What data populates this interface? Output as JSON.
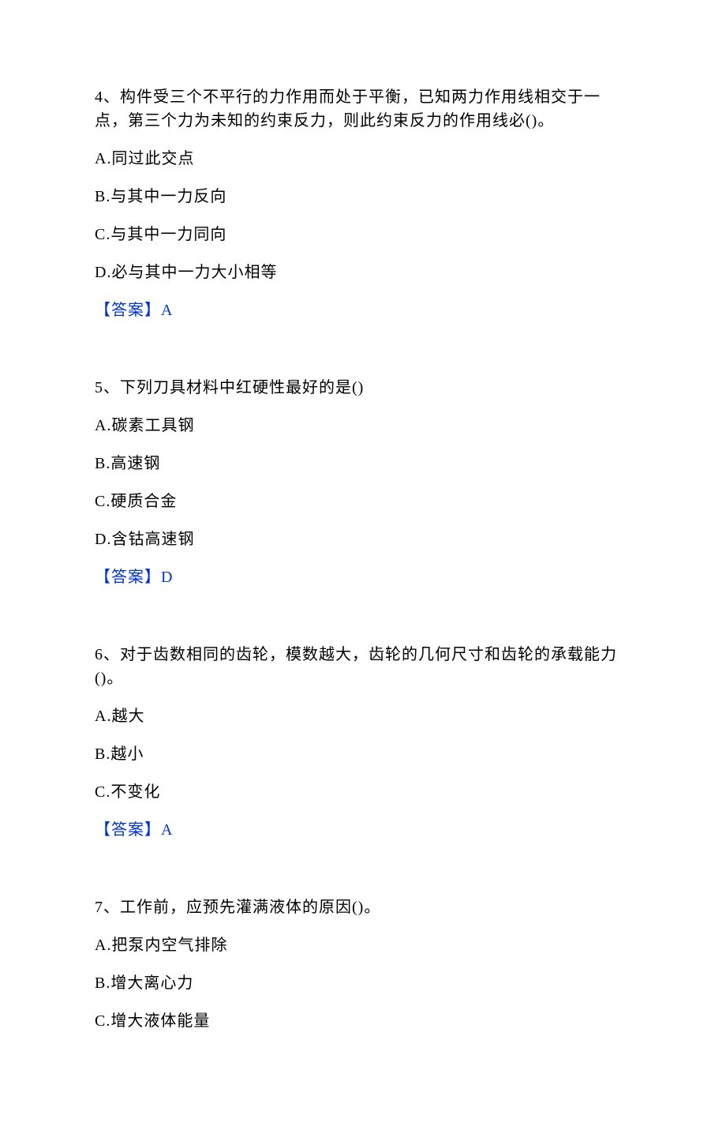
{
  "questions": [
    {
      "number": "4、",
      "text": "构件受三个不平行的力作用而处于平衡，已知两力作用线相交于一点，第三个力为未知的约束反力，则此约束反力的作用线必()。",
      "options": [
        "A.同过此交点",
        "B.与其中一力反向",
        "C.与其中一力同向",
        "D.必与其中一力大小相等"
      ],
      "answer_label": "【答案】",
      "answer_value": "A"
    },
    {
      "number": "5、",
      "text": "下列刀具材料中红硬性最好的是()",
      "options": [
        "A.碳素工具钢",
        "B.高速钢",
        "C.硬质合金",
        "D.含钴高速钢"
      ],
      "answer_label": "【答案】",
      "answer_value": "D"
    },
    {
      "number": "6、",
      "text": "对于齿数相同的齿轮，模数越大，齿轮的几何尺寸和齿轮的承载能力()。",
      "options": [
        "A.越大",
        "B.越小",
        "C.不变化"
      ],
      "answer_label": "【答案】",
      "answer_value": "A"
    },
    {
      "number": "7、",
      "text": "工作前，应预先灌满液体的原因()。",
      "options": [
        "A.把泵内空气排除",
        "B.增大离心力",
        "C.增大液体能量"
      ],
      "answer_label": "",
      "answer_value": ""
    }
  ]
}
